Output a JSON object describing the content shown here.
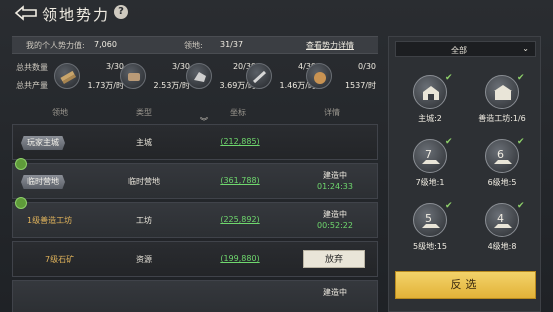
{
  "header": {
    "title": "领地势力",
    "help_symbol": "?"
  },
  "info": {
    "power_label": "我的个人势力值:",
    "power_value": "7,060",
    "territory_label": "领地:",
    "territory_value": "31/37",
    "detail_link": "查看势力详情"
  },
  "resources": {
    "total_label": "总共数量",
    "production_label": "总共产量",
    "items": [
      {
        "icon": "wood-icon",
        "count": "3/30",
        "rate": "1.73万/时"
      },
      {
        "icon": "iron-icon",
        "count": "3/30",
        "rate": "2.53万/时"
      },
      {
        "icon": "stone-icon",
        "count": "20/30",
        "rate": "3.69万/时"
      },
      {
        "icon": "grain-icon",
        "count": "4/30",
        "rate": "1.46万/时"
      },
      {
        "icon": "copper-icon",
        "count": "0/30",
        "rate": "1537/时"
      }
    ]
  },
  "table": {
    "columns": [
      "领地",
      "类型",
      "坐标",
      "详情"
    ],
    "rows": [
      {
        "name": "玩家主城",
        "type": "主城",
        "coord": "(212,885)",
        "status": "",
        "timer": "",
        "action": "",
        "building": false,
        "tag_style": "tag"
      },
      {
        "name": "临时营地",
        "type": "临时营地",
        "coord": "(361,788)",
        "status": "建造中",
        "timer": "01:24:33",
        "action": "",
        "building": true,
        "tag_style": "tag"
      },
      {
        "name": "1级善造工坊",
        "type": "工坊",
        "coord": "(225,892)",
        "status": "建造中",
        "timer": "00:52:22",
        "action": "",
        "building": true,
        "tag_style": "plain"
      },
      {
        "name": "7级石矿",
        "type": "资源",
        "coord": "(199,880)",
        "status": "",
        "timer": "",
        "action": "放弃",
        "building": false,
        "tag_style": "plain"
      },
      {
        "name": "",
        "type": "",
        "coord": "",
        "status": "建造中",
        "timer": "",
        "action": "",
        "building": false,
        "tag_style": "plain"
      }
    ]
  },
  "filter": {
    "selected": "全部",
    "options": [
      {
        "icon": "main-city-icon",
        "label": "主城:2",
        "checked": true
      },
      {
        "icon": "workshop-icon",
        "label": "善造工坊:1/6",
        "checked": true
      },
      {
        "icon": "level-7-land-icon",
        "label": "7级地:1",
        "checked": true,
        "num": "7"
      },
      {
        "icon": "level-6-land-icon",
        "label": "6级地:5",
        "checked": true,
        "num": "6"
      },
      {
        "icon": "level-5-land-icon",
        "label": "5级地:15",
        "checked": true,
        "num": "5"
      },
      {
        "icon": "level-4-land-icon",
        "label": "4级地:8",
        "checked": true,
        "num": "4"
      }
    ],
    "reselect_label": "反选"
  },
  "colors": {
    "accent_gold": "#e2b238",
    "link_green": "#6fd86e",
    "building_green": "#5f9b3a"
  }
}
